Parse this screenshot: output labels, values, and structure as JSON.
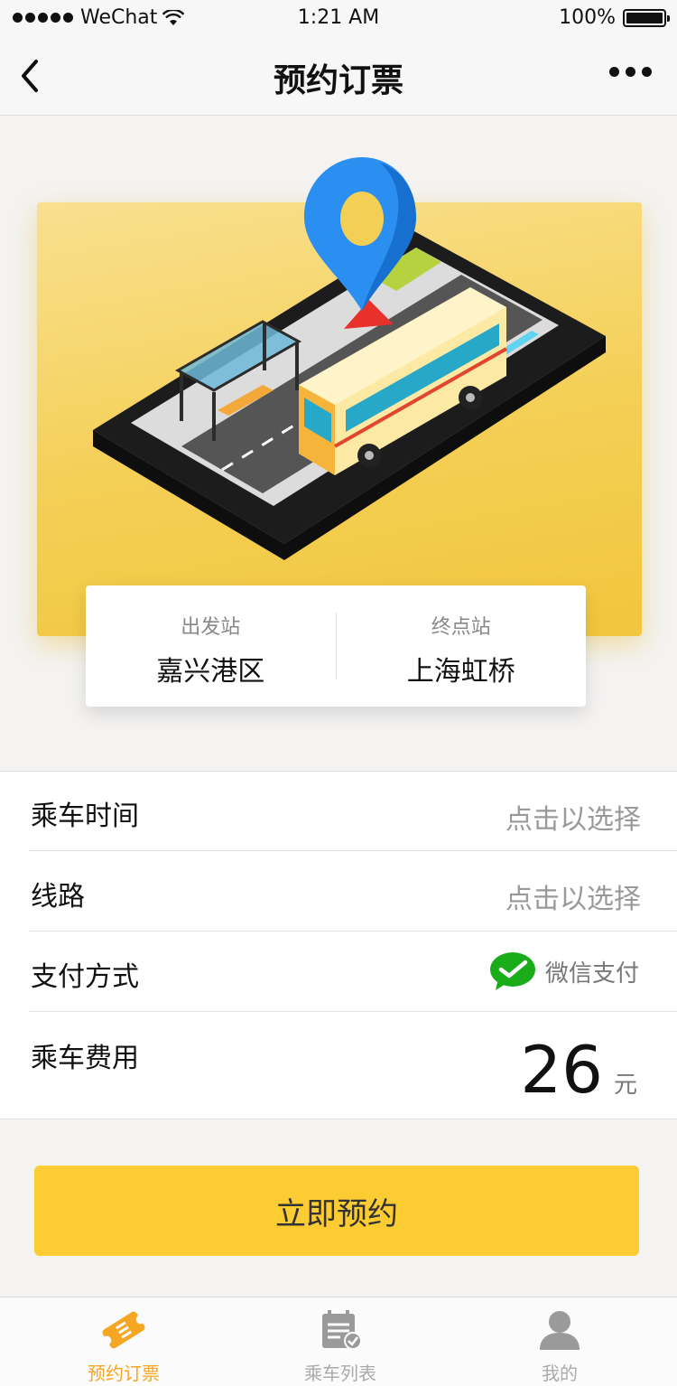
{
  "status_bar": {
    "carrier": "WeChat",
    "time": "1:21 AM",
    "battery": "100%",
    "battery_level": 1.0
  },
  "nav": {
    "title": "预约订票"
  },
  "stations": {
    "departure_label": "出发站",
    "departure_name": "嘉兴港区",
    "arrival_label": "终点站",
    "arrival_name": "上海虹桥"
  },
  "form": {
    "time_label": "乘车时间",
    "time_value": "点击以选择",
    "route_label": "线路",
    "route_value": "点击以选择",
    "payment_label": "支付方式",
    "payment_value": "微信支付",
    "fee_label": "乘车费用",
    "fee_amount": "26",
    "fee_unit": "元"
  },
  "cta": {
    "label": "立即预约"
  },
  "tabs": [
    {
      "label": "预约订票",
      "icon": "ticket-icon",
      "active": true
    },
    {
      "label": "乘车列表",
      "icon": "calendar-check-icon",
      "active": false
    },
    {
      "label": "我的",
      "icon": "user-icon",
      "active": false
    }
  ],
  "colors": {
    "accent": "#fdcc32",
    "tab_active": "#f5a623",
    "wechat_green": "#1aad19"
  }
}
